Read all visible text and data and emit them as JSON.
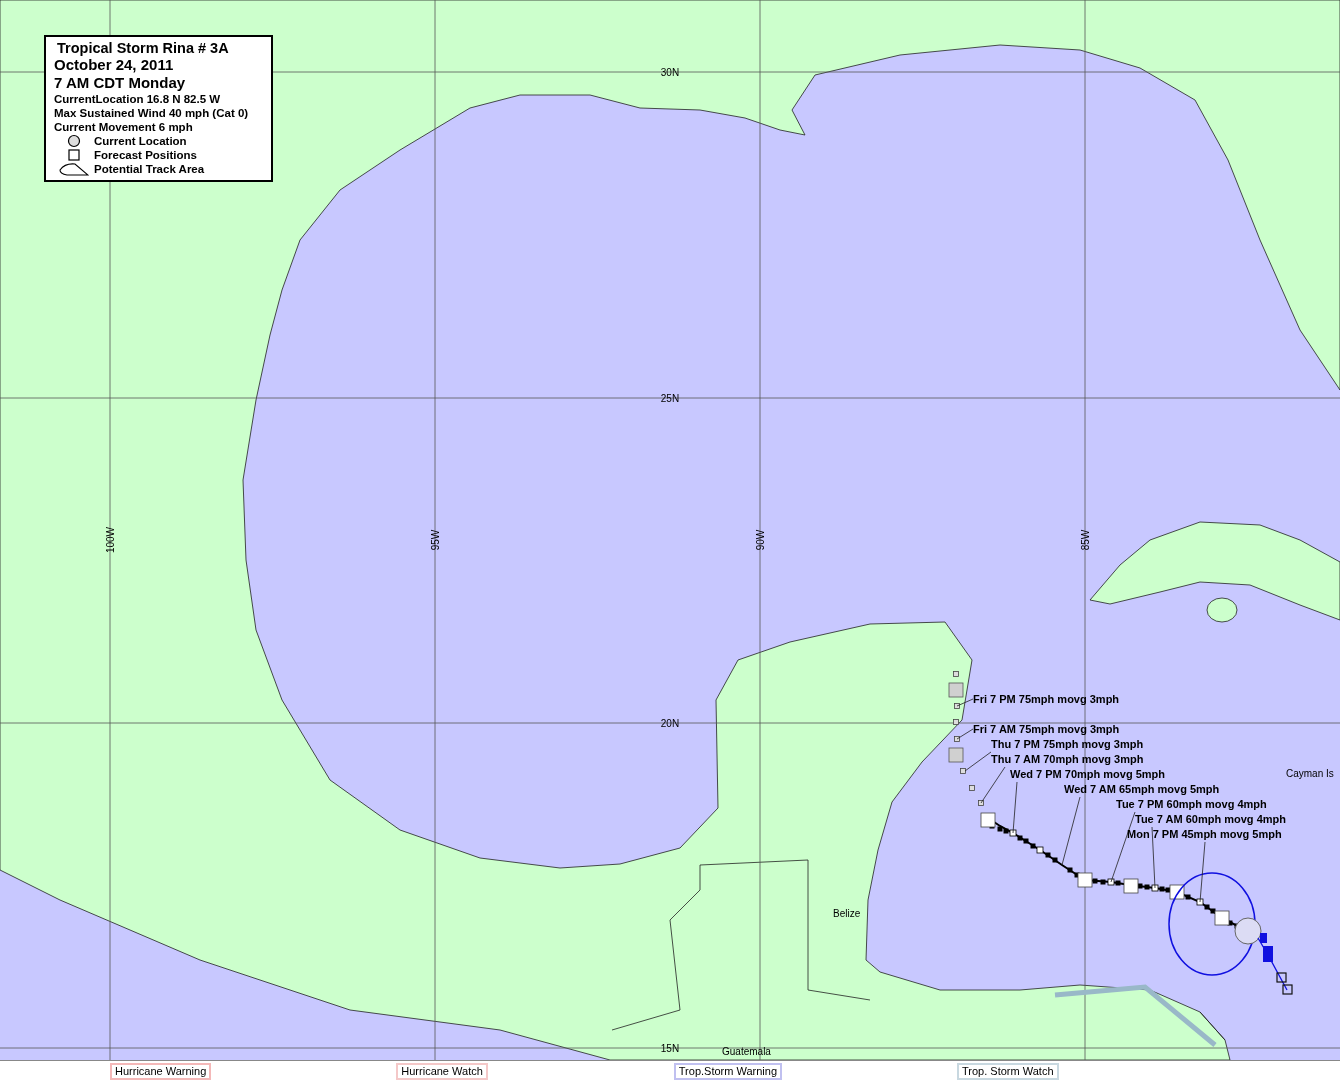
{
  "legend": {
    "title": "Tropical Storm Rina # 3A",
    "date": "October 24, 2011",
    "time": "7 AM CDT Monday",
    "lines": [
      "CurrentLocation 16.8 N  82.5 W",
      "Max Sustained Wind 40 mph (Cat 0)",
      "Current Movement 6 mph"
    ],
    "symbols": [
      {
        "kind": "circle",
        "label": "Current Location"
      },
      {
        "kind": "square",
        "label": "Forecast Positions"
      },
      {
        "kind": "area",
        "label": "Potential Track Area"
      }
    ]
  },
  "grid_labels": [
    {
      "kind": "lat",
      "text": "30N"
    },
    {
      "kind": "lat",
      "text": "25N"
    },
    {
      "kind": "lat",
      "text": "20N"
    },
    {
      "kind": "lat",
      "text": "15N"
    },
    {
      "kind": "lon",
      "text": "100W"
    },
    {
      "kind": "lon",
      "text": "95W"
    },
    {
      "kind": "lon",
      "text": "90W"
    },
    {
      "kind": "lon",
      "text": "85W"
    }
  ],
  "place_labels": [
    "Cayman Is",
    "Belize",
    "Guatemala"
  ],
  "forecast_labels": [
    "Fri 7 PM 75mph movg 3mph",
    "Fri 7 AM 75mph movg 3mph",
    "Thu 7 PM 75mph movg 3mph",
    "Thu 7 AM 70mph movg 3mph",
    "Wed 7 PM 70mph movg 5mph",
    "Wed 7 AM 65mph movg 5mph",
    "Tue 7 PM 60mph movg 4mph",
    "Tue 7 AM 60mph movg 4mph",
    "Mon 7 PM 45mph movg 5mph"
  ],
  "warning_key": [
    {
      "label": "Hurricane Warning",
      "color": "#f4b8b8"
    },
    {
      "label": "Hurricane  Watch",
      "color": "#f4c8c8"
    },
    {
      "label": "Trop.Storm Warning",
      "color": "#c0c0f0"
    },
    {
      "label": "Trop. Storm Watch",
      "color": "#c8d8e0"
    }
  ]
}
